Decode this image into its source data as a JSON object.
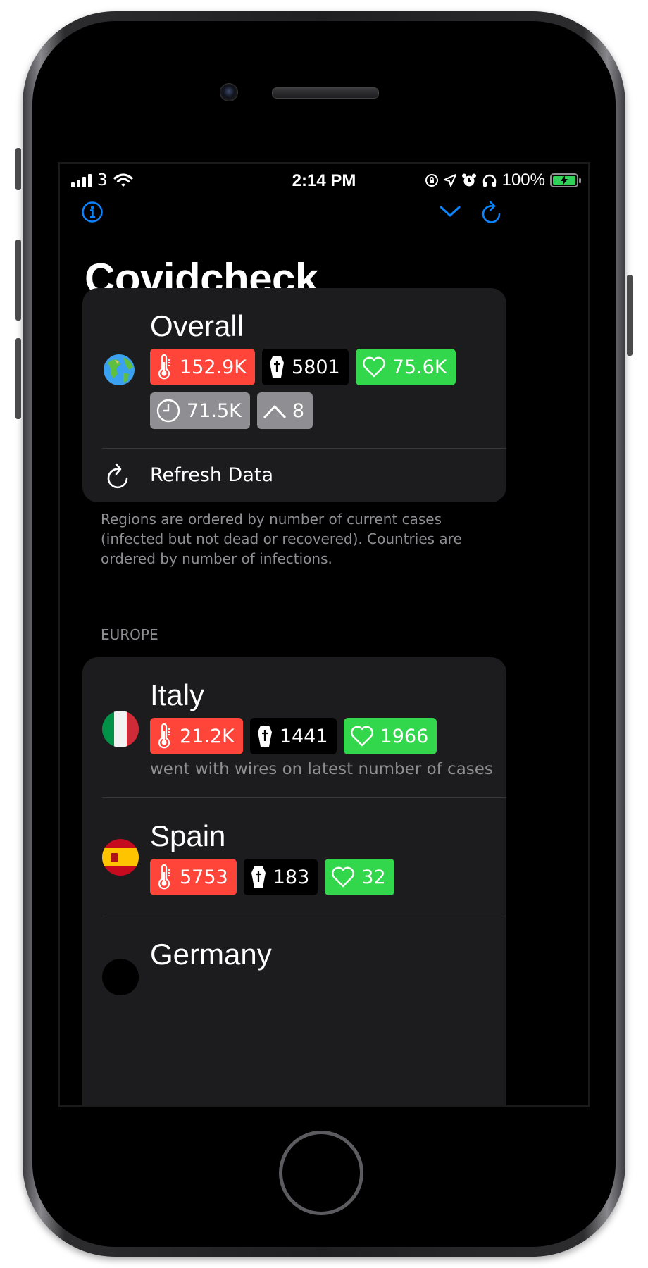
{
  "status": {
    "carrier": "3",
    "time": "2:14 PM",
    "battery": "100%"
  },
  "app": {
    "title": "Covidcheck"
  },
  "overall": {
    "label": "Overall",
    "icon": "globe-emoji",
    "infected": "152.9K",
    "deaths": "5801",
    "recovered": "75.6K",
    "current": "71.5K",
    "increase": "8",
    "refresh_label": "Refresh Data"
  },
  "footer": "Regions are ordered by number of current cases (infected but not dead or recovered). Countries are ordered by number of infections.",
  "sections": [
    {
      "header": "EUROPE",
      "countries": [
        {
          "name": "Italy",
          "infected": "21.2K",
          "deaths": "1441",
          "recovered": "1966",
          "note": "went with wires on latest number of cases"
        },
        {
          "name": "Spain",
          "infected": "5753",
          "deaths": "183",
          "recovered": "32"
        },
        {
          "name": "Germany"
        }
      ]
    }
  ],
  "colors": {
    "accent": "#0a84ff",
    "infected": "#ff453a",
    "recovered": "#32d74b",
    "neutral": "#8e8e93",
    "card": "#1c1c1e"
  }
}
